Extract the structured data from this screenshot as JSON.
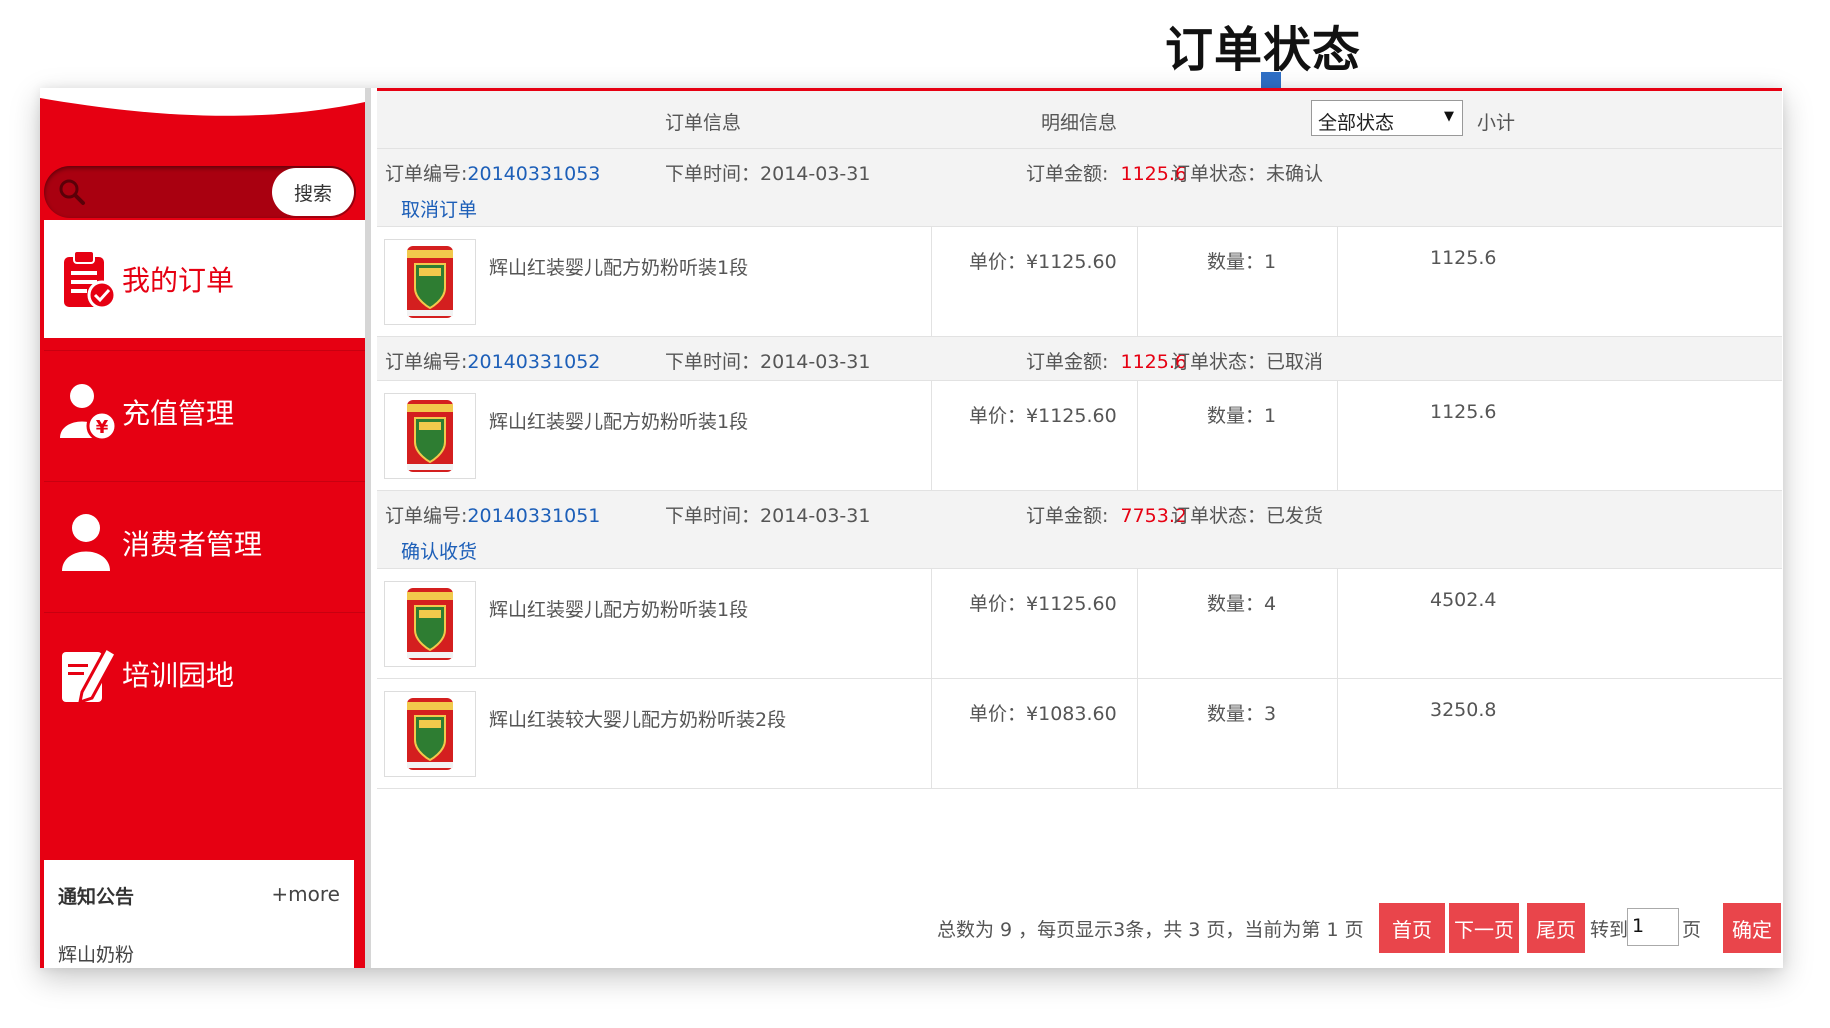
{
  "annotation": {
    "title": "订单状态"
  },
  "sidebar": {
    "search_button": "搜索",
    "items": [
      {
        "label": "我的订单",
        "icon": "clipboard-check-icon",
        "active": true
      },
      {
        "label": "充值管理",
        "icon": "user-yen-icon",
        "active": false
      },
      {
        "label": "消费者管理",
        "icon": "user-icon",
        "active": false
      },
      {
        "label": "培训园地",
        "icon": "edit-pencil-icon",
        "active": false
      }
    ],
    "notice": {
      "title": "通知公告",
      "more": "+more",
      "items": [
        "辉山奶粉"
      ]
    }
  },
  "table": {
    "headers": {
      "order_info": "订单信息",
      "detail_info": "明细信息",
      "status_filter": "全部状态",
      "subtotal": "小计"
    }
  },
  "orders": [
    {
      "number_label": "订单编号:",
      "number": "20140331053",
      "time_label": "下单时间：",
      "time": "2014-03-31",
      "amount_label": "订单金额:",
      "amount": "1125.6",
      "status_label": "订单状态：",
      "status": "未确认",
      "action": "取消订单",
      "items": [
        {
          "name": "辉山红装婴儿配方奶粉听装1段",
          "price_label": "单价：",
          "price": "¥1125.60",
          "qty_label": "数量：",
          "qty": "1",
          "subtotal": "1125.6"
        }
      ]
    },
    {
      "number_label": "订单编号:",
      "number": "20140331052",
      "time_label": "下单时间：",
      "time": "2014-03-31",
      "amount_label": "订单金额:",
      "amount": "1125.6",
      "status_label": "订单状态：",
      "status": "已取消",
      "action": "",
      "items": [
        {
          "name": "辉山红装婴儿配方奶粉听装1段",
          "price_label": "单价：",
          "price": "¥1125.60",
          "qty_label": "数量：",
          "qty": "1",
          "subtotal": "1125.6"
        }
      ]
    },
    {
      "number_label": "订单编号:",
      "number": "20140331051",
      "time_label": "下单时间：",
      "time": "2014-03-31",
      "amount_label": "订单金额:",
      "amount": "7753.2",
      "status_label": "订单状态：",
      "status": "已发货",
      "action": "确认收货",
      "items": [
        {
          "name": "辉山红装婴儿配方奶粉听装1段",
          "price_label": "单价：",
          "price": "¥1125.60",
          "qty_label": "数量：",
          "qty": "4",
          "subtotal": "4502.4"
        },
        {
          "name": "辉山红装较大婴儿配方奶粉听装2段",
          "price_label": "单价：",
          "price": "¥1083.60",
          "qty_label": "数量：",
          "qty": "3",
          "subtotal": "3250.8"
        }
      ]
    }
  ],
  "pagination": {
    "summary": "总数为 9 ，每页显示3条，共 3 页，当前为第 1 页",
    "first": "首页",
    "next": "下一页",
    "last": "尾页",
    "goto_label": "转到",
    "page_value": "1",
    "page_suffix": "页",
    "confirm": "确定"
  },
  "colors": {
    "brand_red": "#e60012",
    "link_blue": "#1d5fb8",
    "button_red": "#e9454b"
  }
}
